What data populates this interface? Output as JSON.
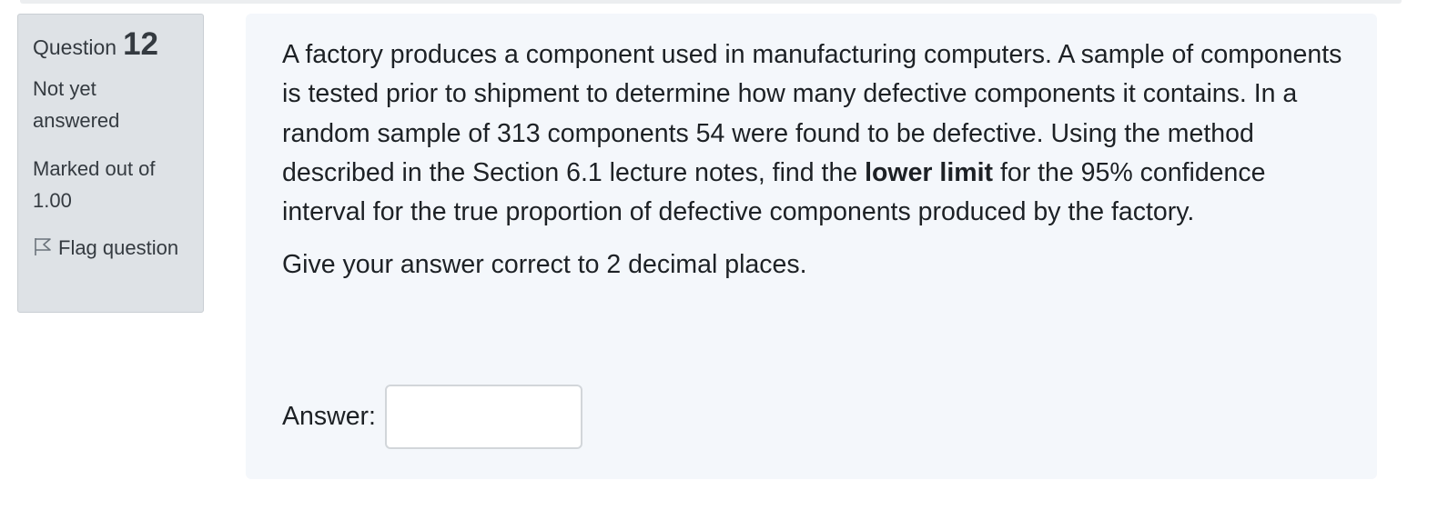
{
  "question_info": {
    "question_word": "Question",
    "question_number": "12",
    "state": "Not yet answered",
    "marked_out_of": "Marked out of 1.00",
    "flag_label": "Flag question"
  },
  "question": {
    "text_before_bold": "A factory produces a component used in manufacturing computers. A sample of components is tested prior to shipment to determine how many defective components it contains. In a random sample of 313 components 54 were found to be defective. Using the method described in the Section 6.1 lecture notes, find the ",
    "bold_text": "lower limit",
    "text_after_bold": " for the 95% confidence interval for the true proportion of defective components produced by the factory.",
    "instruction": "Give your answer correct to 2 decimal places."
  },
  "answer": {
    "label": "Answer:",
    "value": ""
  },
  "icons": {
    "flag": "flag-icon"
  },
  "colors": {
    "info_panel_bg": "#dee2e6",
    "content_panel_bg": "#f4f7fb",
    "text": "#1d2125"
  }
}
